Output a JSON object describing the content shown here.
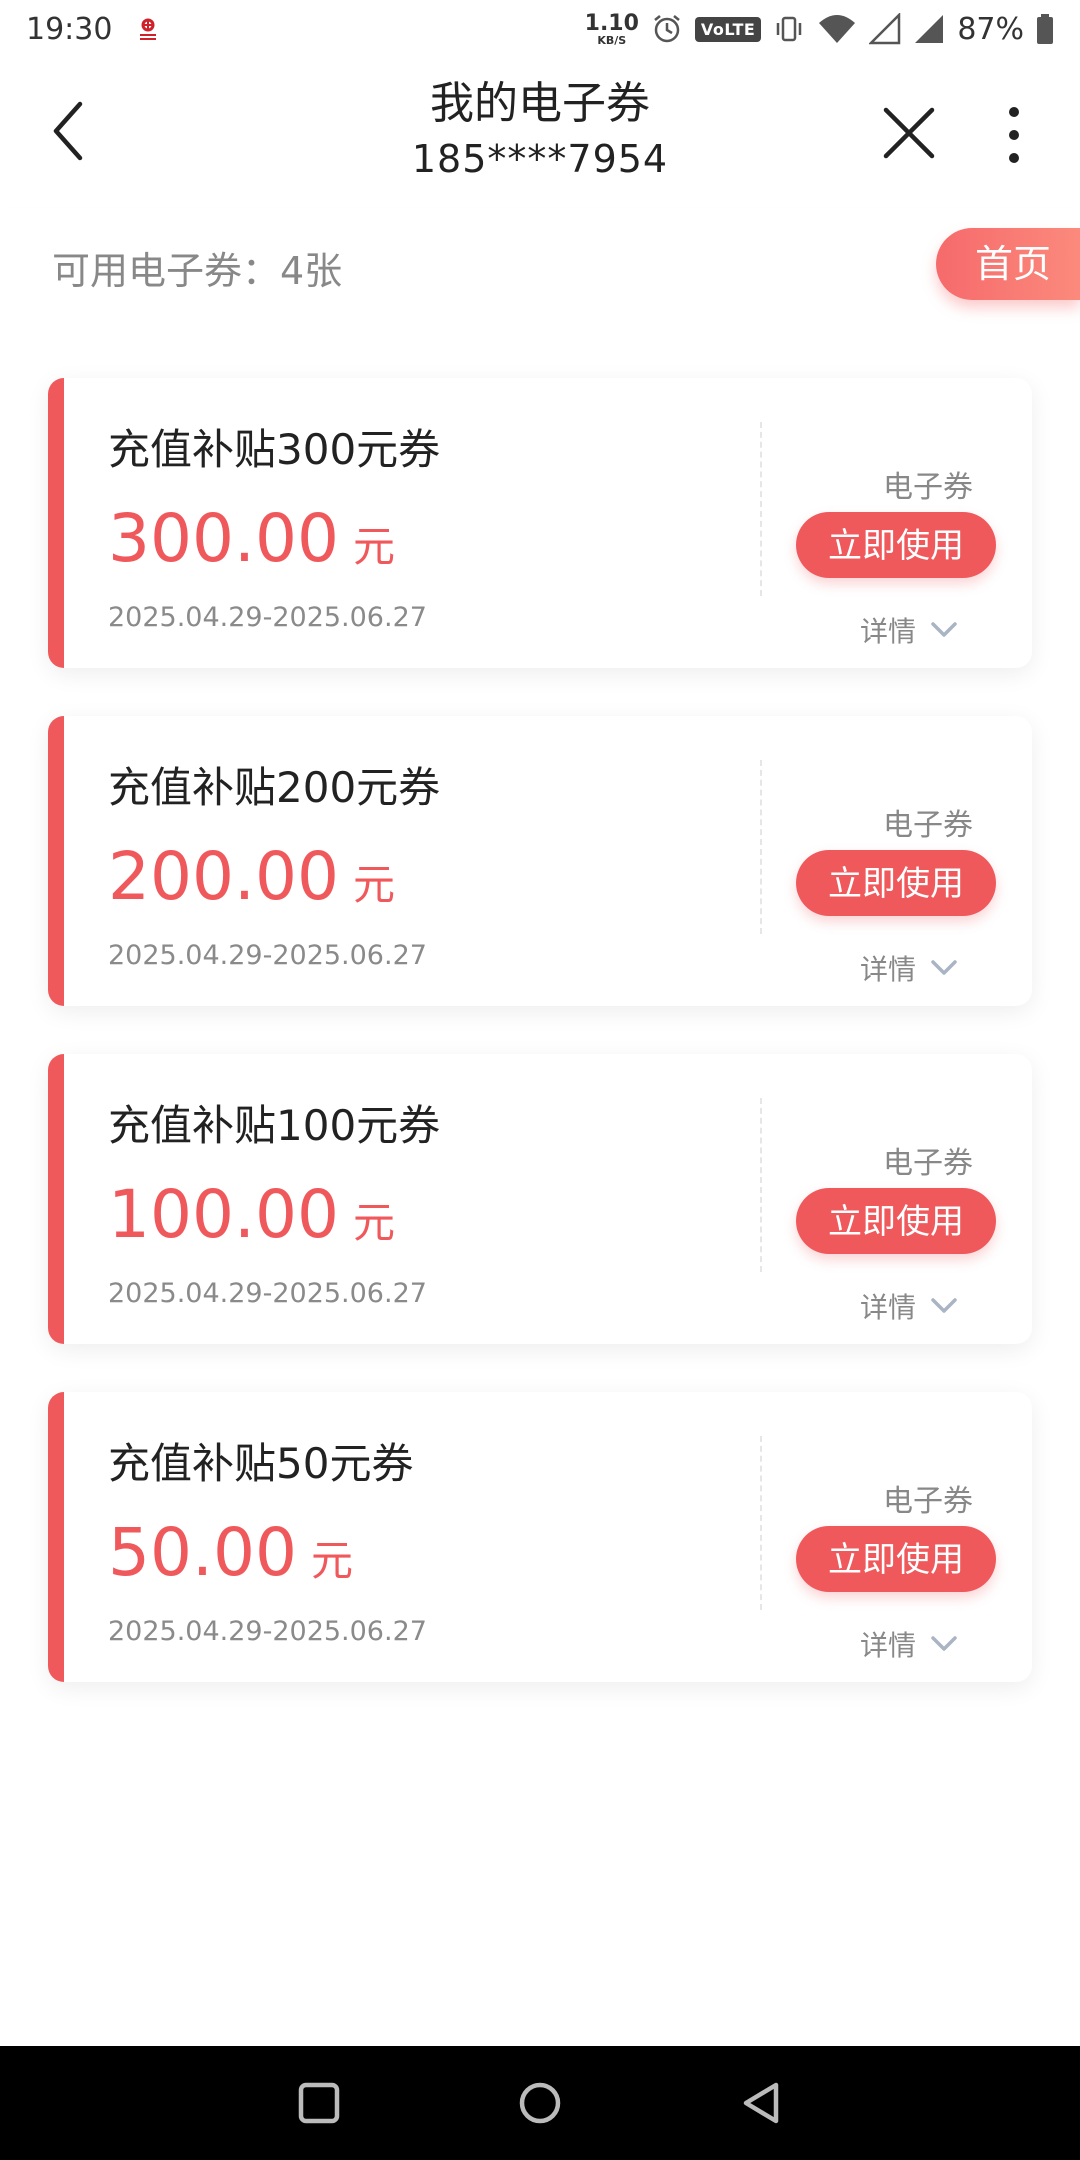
{
  "status_bar": {
    "time": "19:30",
    "net_speed_value": "1.10",
    "net_speed_unit": "KB/S",
    "volte": "VoLTE",
    "battery": "87%",
    "icons": [
      "carrier-logo-icon",
      "alarm-icon",
      "vibrate-icon",
      "wifi-icon",
      "signal-icon",
      "signal-icon",
      "battery-icon"
    ]
  },
  "header": {
    "title": "我的电子券",
    "subtitle": "185****7954"
  },
  "summary": {
    "count_label": "可用电子券：4张",
    "home_label": "首页"
  },
  "coupons": [
    {
      "title": "充值补贴300元券",
      "amount": "300.00",
      "unit": "元",
      "date": "2025.04.29-2025.06.27",
      "type": "电子券",
      "action": "立即使用",
      "detail": "详情"
    },
    {
      "title": "充值补贴200元券",
      "amount": "200.00",
      "unit": "元",
      "date": "2025.04.29-2025.06.27",
      "type": "电子券",
      "action": "立即使用",
      "detail": "详情"
    },
    {
      "title": "充值补贴100元券",
      "amount": "100.00",
      "unit": "元",
      "date": "2025.04.29-2025.06.27",
      "type": "电子券",
      "action": "立即使用",
      "detail": "详情"
    },
    {
      "title": "充值补贴50元券",
      "amount": "50.00",
      "unit": "元",
      "date": "2025.04.29-2025.06.27",
      "type": "电子券",
      "action": "立即使用",
      "detail": "详情"
    }
  ],
  "colors": {
    "accent": "#f0595c",
    "home_gradient_start": "#f66a6c",
    "home_gradient_end": "#fb8a7c"
  },
  "nav_bar": {
    "icons": [
      "recents-square-icon",
      "home-circle-icon",
      "back-triangle-icon"
    ]
  }
}
